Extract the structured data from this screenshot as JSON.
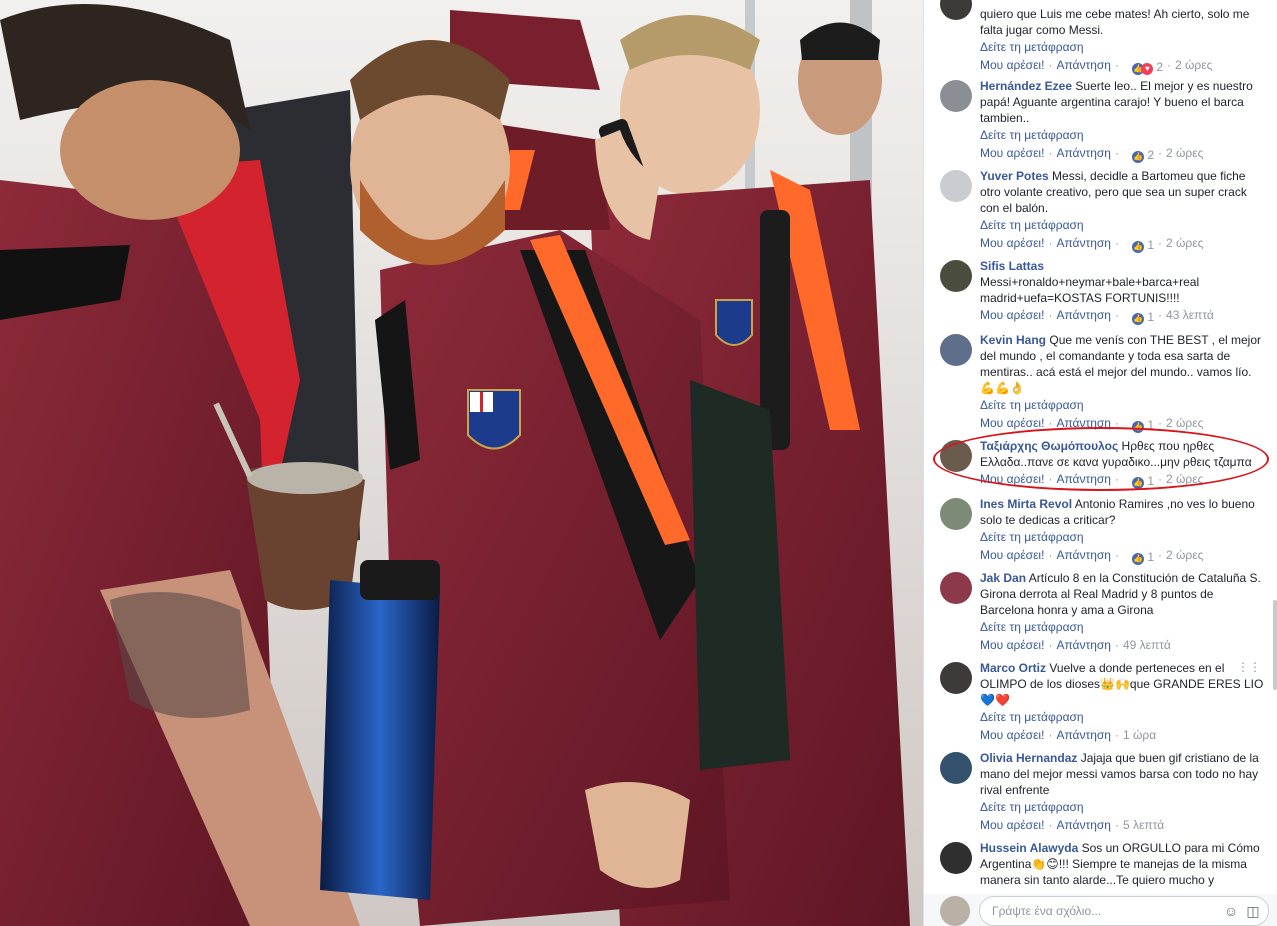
{
  "comments": [
    {
      "name": "",
      "text": "quiero que Luis me cebe mates! Ah cierto, solo me falta jugar como Messi.",
      "see_translation": "Δείτε τη μετάφραση",
      "like": "Μου αρέσει!",
      "reply": "Απάντηση",
      "reactions": "2",
      "time": "2 ώρες",
      "reaction_types": [
        "like",
        "love"
      ],
      "avatar_color": "#3d3b38"
    },
    {
      "name": "Hernández Ezee",
      "text": "Suerte leo.. El mejor y es nuestro papá! Aguante argentina carajo! Y bueno el barca tambien..",
      "see_translation": "Δείτε τη μετάφραση",
      "like": "Μου αρέσει!",
      "reply": "Απάντηση",
      "reactions": "2",
      "time": "2 ώρες",
      "reaction_types": [
        "like"
      ],
      "avatar_color": "#8a8f96"
    },
    {
      "name": "Yuver Potes",
      "text": "Messi, decidle a Bartomeu que fiche otro volante creativo, pero que sea un super crack con el balón.",
      "see_translation": "Δείτε τη μετάφραση",
      "like": "Μου αρέσει!",
      "reply": "Απάντηση",
      "reactions": "1",
      "time": "2 ώρες",
      "reaction_types": [
        "like"
      ],
      "avatar_color": "#c9ccd1"
    },
    {
      "name": "Sifis Lattas",
      "text": "Messi+ronaldo+neymar+bale+barca+real madrid+uefa=KOSTAS FORTUNIS!!!!",
      "see_translation": "",
      "like": "Μου αρέσει!",
      "reply": "Απάντηση",
      "reactions": "1",
      "time": "43 λεπτά",
      "reaction_types": [
        "like"
      ],
      "avatar_color": "#4a4d3e"
    },
    {
      "name": "Kevin Hang",
      "text": "Que me venís con THE BEST , el mejor del mundo , el comandante y toda esa sarta de mentiras.. acá está el mejor del mundo.. vamos lío. 💪💪👌",
      "see_translation": "Δείτε τη μετάφραση",
      "like": "Μου αρέσει!",
      "reply": "Απάντηση",
      "reactions": "1",
      "time": "2 ώρες",
      "reaction_types": [
        "like"
      ],
      "avatar_color": "#5f6e8a"
    },
    {
      "name": "Ταξιάρχης Θωμόπουλος",
      "text": "Ηρθες που ηρθες Ελλαδα..πανε σε κανα γυραδικο...μην ρθεις τζαμπα",
      "see_translation": "",
      "like": "Μου αρέσει!",
      "reply": "Απάντηση",
      "reactions": "1",
      "time": "2 ώρες",
      "reaction_types": [
        "like"
      ],
      "avatar_color": "#6b5a4e"
    },
    {
      "name": "Ines Mirta Revol",
      "text": "Antonio Ramires ,no ves lo bueno solo te dedicas a criticar?",
      "see_translation": "Δείτε τη μετάφραση",
      "like": "Μου αρέσει!",
      "reply": "Απάντηση",
      "reactions": "1",
      "time": "2 ώρες",
      "reaction_types": [
        "like"
      ],
      "avatar_color": "#7d8a76"
    },
    {
      "name": "Jak Dan",
      "text": "Artículo 8 en la Constitución de Cataluña S. Girona derrota al Real Madrid y 8 puntos de Barcelona honra y ama a Girona",
      "see_translation": "Δείτε τη μετάφραση",
      "like": "Μου αρέσει!",
      "reply": "Απάντηση",
      "reactions": "",
      "time": "49 λεπτά",
      "reaction_types": [],
      "avatar_color": "#8c3a4a"
    },
    {
      "name": "Marco Ortiz",
      "text": "Vuelve a donde perteneces en el OLIMPO de los dioses👑🙌que GRANDE ERES LIO💙❤️",
      "see_translation": "Δείτε τη μετάφραση",
      "like": "Μου αρέσει!",
      "reply": "Απάντηση",
      "reactions": "",
      "time": "1 ώρα",
      "reaction_types": [],
      "avatar_color": "#3f3a3a"
    },
    {
      "name": "Olivia Hernandaz",
      "text": "Jajaja que buen gif cristiano de la mano del mejor messi vamos barsa con todo no hay rival enfrente",
      "see_translation": "Δείτε τη μετάφραση",
      "like": "Μου αρέσει!",
      "reply": "Απάντηση",
      "reactions": "",
      "time": "5 λεπτά",
      "reaction_types": [],
      "avatar_color": "#34526e"
    },
    {
      "name": "Hussein Alawyda",
      "text": "Sos un ORGULLO para mi Cómo Argentina👏😊!!! Siempre te manejas de la misma manera sin tanto alarde...Te quiero mucho y",
      "see_translation": "",
      "like": "",
      "reply": "",
      "reactions": "",
      "time": "",
      "reaction_types": [],
      "avatar_color": "#2f2f2f"
    }
  ],
  "composer": {
    "placeholder": "Γράψτε ένα σχόλιο...",
    "emoji_icon": "smiley-icon",
    "sticker_icon": "sticker-icon"
  },
  "menu_icon": "more-options-icon",
  "colors": {
    "link": "#385898",
    "meta": "#90949c",
    "highlight": "#d9141b",
    "kit_maroon": "#7a1f2e",
    "kit_orange": "#ff6a2a"
  }
}
